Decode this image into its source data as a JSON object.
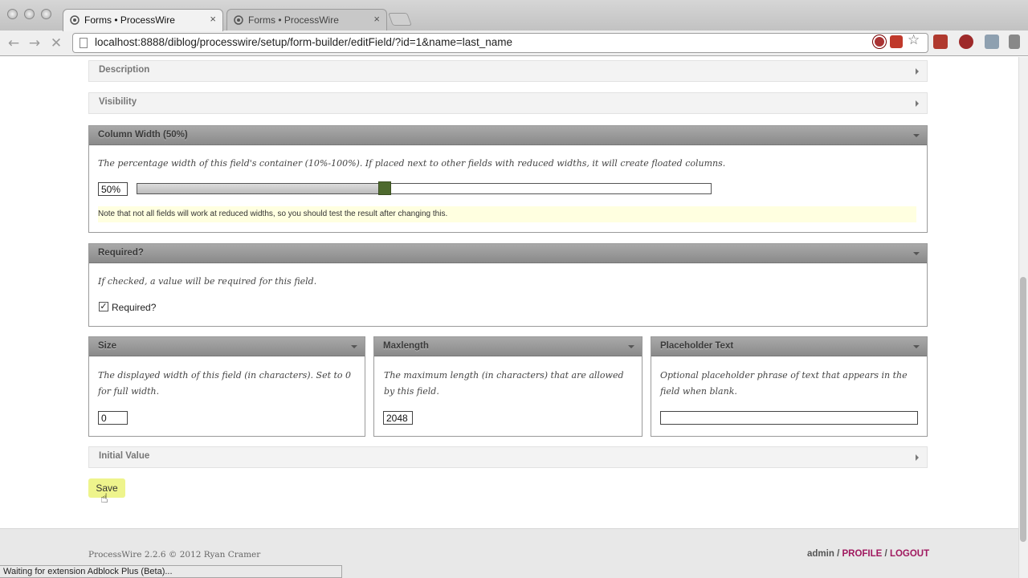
{
  "browser": {
    "tabs": [
      {
        "title": "Forms • ProcessWire",
        "active": true
      },
      {
        "title": "Forms • ProcessWire",
        "active": false
      }
    ],
    "url": "localhost:8888/diblog/processwire/setup/form-builder/editField/?id=1&name=last_name",
    "status": "Waiting for extension Adblock Plus (Beta)..."
  },
  "panels": {
    "description": {
      "title": "Description"
    },
    "visibility": {
      "title": "Visibility"
    },
    "column_width": {
      "title": "Column Width (50%)",
      "description": "The percentage width of this field's container (10%-100%). If placed next to other fields with reduced widths, it will create floated columns.",
      "value": "50%",
      "slider_percent": 50,
      "note": "Note that not all fields will work at reduced widths, so you should test the result after changing this."
    },
    "required": {
      "title": "Required?",
      "description": "If checked, a value will be required for this field.",
      "checkbox_label": "Required?",
      "checked": true
    },
    "size": {
      "title": "Size",
      "description": "The displayed width of this field (in characters). Set to 0 for full width.",
      "value": "0"
    },
    "maxlength": {
      "title": "Maxlength",
      "description": "The maximum length (in characters) that are allowed by this field.",
      "value": "2048"
    },
    "placeholder": {
      "title": "Placeholder Text",
      "description": "Optional placeholder phrase of text that appears in the field when blank.",
      "value": ""
    },
    "initial_value": {
      "title": "Initial Value"
    }
  },
  "actions": {
    "save_label": "Save"
  },
  "footer": {
    "copyright": "ProcessWire 2.2.6 © 2012 Ryan Cramer",
    "user": "admin",
    "separator": "/",
    "profile_label": "Profile",
    "logout_label": "Logout"
  },
  "colors": {
    "header_gray": "#9a9a9a",
    "slider_handle": "#4e6a2e",
    "save_button": "#eef48c",
    "link": "#a0195f",
    "note_bg": "#ffffe0"
  }
}
